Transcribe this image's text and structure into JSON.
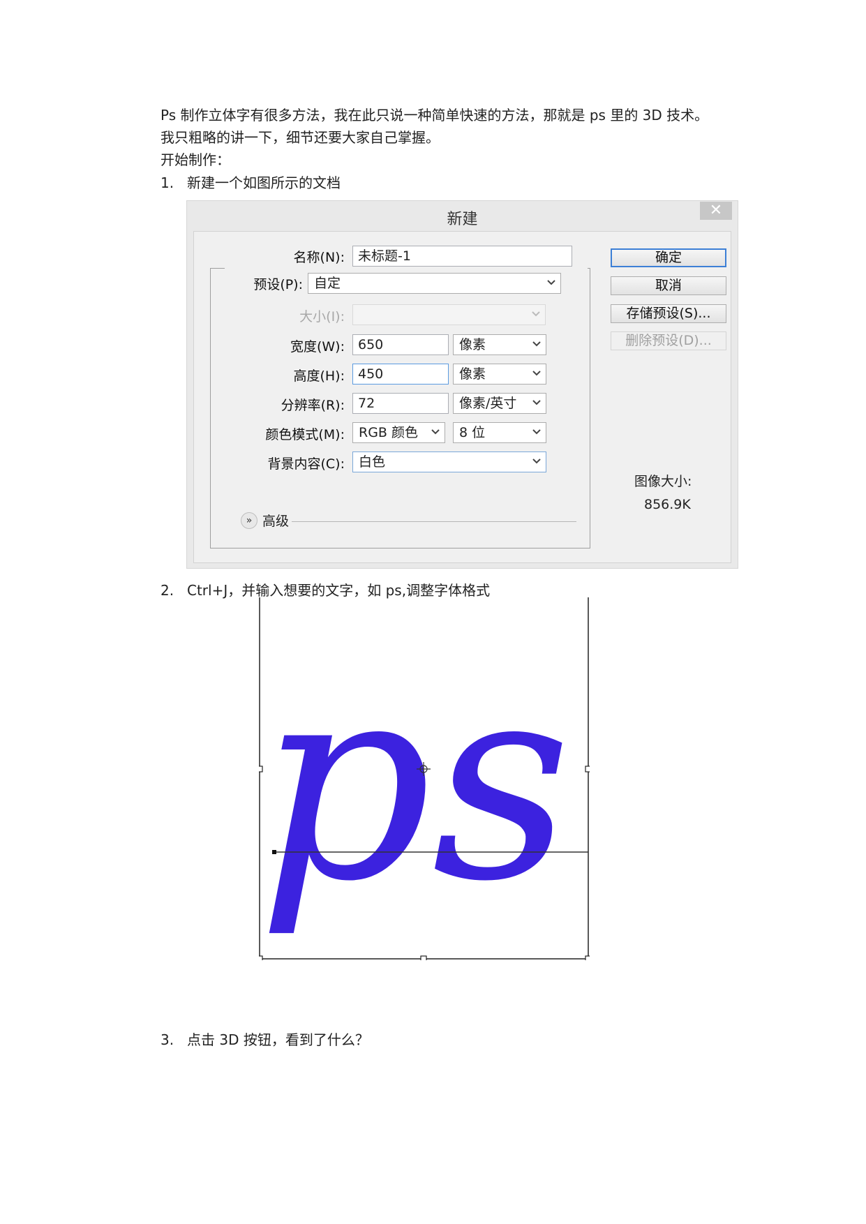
{
  "intro": {
    "line1": "Ps 制作立体字有很多方法，我在此只说一种简单快速的方法，那就是 ps 里的 3D 技术。",
    "line2": "我只粗略的讲一下，细节还要大家自己掌握。",
    "line3": "开始制作："
  },
  "steps": [
    {
      "num": "1.",
      "text": "新建一个如图所示的文档"
    },
    {
      "num": "2.",
      "text": "Ctrl+J，并输入想要的文字，如 ps,调整字体格式"
    },
    {
      "num": "3.",
      "text": "点击 3D 按钮，看到了什么？"
    }
  ],
  "dialog": {
    "title": "新建",
    "close": "✕",
    "name_label": "名称(N):",
    "name_value": "未标题-1",
    "preset_label": "预设(P):",
    "preset_value": "自定",
    "size_label": "大小(I):",
    "size_value": "",
    "width_label": "宽度(W):",
    "width_value": "650",
    "width_unit": "像素",
    "height_label": "高度(H):",
    "height_value": "450",
    "height_unit": "像素",
    "res_label": "分辨率(R):",
    "res_value": "72",
    "res_unit": "像素/英寸",
    "color_label": "颜色模式(M):",
    "color_value": "RGB 颜色",
    "bit_value": "8 位",
    "bg_label": "背景内容(C):",
    "bg_value": "白色",
    "advanced": "高级",
    "ok": "确定",
    "cancel": "取消",
    "save_preset": "存储预设(S)...",
    "delete_preset": "删除预设(D)...",
    "image_size_label": "图像大小:",
    "image_size_value": "856.9K"
  },
  "ps_text": "ps",
  "colors": {
    "ps_text": "#3c22df",
    "default_button_border": "#3c7fd6"
  }
}
